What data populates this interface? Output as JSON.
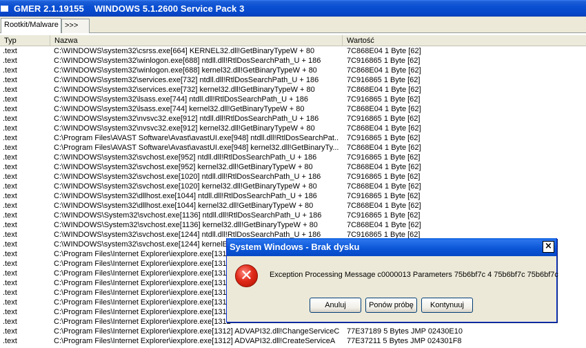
{
  "window": {
    "title": "GMER 2.1.19155    WINDOWS 5.1.2600 Service Pack 3"
  },
  "tabs": [
    {
      "label": "Rootkit/Malware"
    },
    {
      "label": ">>>"
    }
  ],
  "columns": {
    "typ": "Typ",
    "nazwa": "Nazwa",
    "wartosc": "Wartość"
  },
  "rows": [
    {
      "typ": ".text",
      "nazwa": "C:\\WINDOWS\\system32\\csrss.exe[664] KERNEL32.dll!GetBinaryTypeW + 80",
      "wartosc": "7C868E04 1 Byte  [62]"
    },
    {
      "typ": ".text",
      "nazwa": "C:\\WINDOWS\\system32\\winlogon.exe[688] ntdll.dll!RtlDosSearchPath_U + 186",
      "wartosc": "7C916865 1 Byte  [62]"
    },
    {
      "typ": ".text",
      "nazwa": "C:\\WINDOWS\\system32\\winlogon.exe[688] kernel32.dll!GetBinaryTypeW + 80",
      "wartosc": "7C868E04 1 Byte  [62]"
    },
    {
      "typ": ".text",
      "nazwa": "C:\\WINDOWS\\system32\\services.exe[732] ntdll.dll!RtlDosSearchPath_U + 186",
      "wartosc": "7C916865 1 Byte  [62]"
    },
    {
      "typ": ".text",
      "nazwa": "C:\\WINDOWS\\system32\\services.exe[732] kernel32.dll!GetBinaryTypeW + 80",
      "wartosc": "7C868E04 1 Byte  [62]"
    },
    {
      "typ": ".text",
      "nazwa": "C:\\WINDOWS\\system32\\lsass.exe[744] ntdll.dll!RtlDosSearchPath_U + 186",
      "wartosc": "7C916865 1 Byte  [62]"
    },
    {
      "typ": ".text",
      "nazwa": "C:\\WINDOWS\\system32\\lsass.exe[744] kernel32.dll!GetBinaryTypeW + 80",
      "wartosc": "7C868E04 1 Byte  [62]"
    },
    {
      "typ": ".text",
      "nazwa": "C:\\WINDOWS\\system32\\nvsvc32.exe[912] ntdll.dll!RtlDosSearchPath_U + 186",
      "wartosc": "7C916865 1 Byte  [62]"
    },
    {
      "typ": ".text",
      "nazwa": "C:\\WINDOWS\\system32\\nvsvc32.exe[912] kernel32.dll!GetBinaryTypeW + 80",
      "wartosc": "7C868E04 1 Byte  [62]"
    },
    {
      "typ": ".text",
      "nazwa": "C:\\Program Files\\AVAST Software\\Avast\\avastUI.exe[948] ntdll.dll!RtlDosSearchPat...",
      "wartosc": "7C916865 1 Byte  [62]"
    },
    {
      "typ": ".text",
      "nazwa": "C:\\Program Files\\AVAST Software\\Avast\\avastUI.exe[948] kernel32.dll!GetBinaryTy...",
      "wartosc": "7C868E04 1 Byte  [62]"
    },
    {
      "typ": ".text",
      "nazwa": "C:\\WINDOWS\\system32\\svchost.exe[952] ntdll.dll!RtlDosSearchPath_U + 186",
      "wartosc": "7C916865 1 Byte  [62]"
    },
    {
      "typ": ".text",
      "nazwa": "C:\\WINDOWS\\system32\\svchost.exe[952] kernel32.dll!GetBinaryTypeW + 80",
      "wartosc": "7C868E04 1 Byte  [62]"
    },
    {
      "typ": ".text",
      "nazwa": "C:\\WINDOWS\\system32\\svchost.exe[1020] ntdll.dll!RtlDosSearchPath_U + 186",
      "wartosc": "7C916865 1 Byte  [62]"
    },
    {
      "typ": ".text",
      "nazwa": "C:\\WINDOWS\\system32\\svchost.exe[1020] kernel32.dll!GetBinaryTypeW + 80",
      "wartosc": "7C868E04 1 Byte  [62]"
    },
    {
      "typ": ".text",
      "nazwa": "C:\\WINDOWS\\system32\\dllhost.exe[1044] ntdll.dll!RtlDosSearchPath_U + 186",
      "wartosc": "7C916865 1 Byte  [62]"
    },
    {
      "typ": ".text",
      "nazwa": "C:\\WINDOWS\\system32\\dllhost.exe[1044] kernel32.dll!GetBinaryTypeW + 80",
      "wartosc": "7C868E04 1 Byte  [62]"
    },
    {
      "typ": ".text",
      "nazwa": "C:\\WINDOWS\\System32\\svchost.exe[1136] ntdll.dll!RtlDosSearchPath_U + 186",
      "wartosc": "7C916865 1 Byte  [62]"
    },
    {
      "typ": ".text",
      "nazwa": "C:\\WINDOWS\\System32\\svchost.exe[1136] kernel32.dll!GetBinaryTypeW + 80",
      "wartosc": "7C868E04 1 Byte  [62]"
    },
    {
      "typ": ".text",
      "nazwa": "C:\\WINDOWS\\system32\\svchost.exe[1244] ntdll.dll!RtlDosSearchPath_U + 186",
      "wartosc": "7C916865 1 Byte  [62]"
    },
    {
      "typ": ".text",
      "nazwa": "C:\\WINDOWS\\system32\\svchost.exe[1244] kernelE",
      "wartosc": ""
    },
    {
      "typ": ".text",
      "nazwa": "C:\\Program Files\\Internet Explorer\\iexplore.exe[1312",
      "wartosc": ""
    },
    {
      "typ": ".text",
      "nazwa": "C:\\Program Files\\Internet Explorer\\iexplore.exe[1312",
      "wartosc": ""
    },
    {
      "typ": ".text",
      "nazwa": "C:\\Program Files\\Internet Explorer\\iexplore.exe[1312",
      "wartosc": ""
    },
    {
      "typ": ".text",
      "nazwa": "C:\\Program Files\\Internet Explorer\\iexplore.exe[1312",
      "wartosc": ""
    },
    {
      "typ": ".text",
      "nazwa": "C:\\Program Files\\Internet Explorer\\iexplore.exe[1312",
      "wartosc": ""
    },
    {
      "typ": ".text",
      "nazwa": "C:\\Program Files\\Internet Explorer\\iexplore.exe[1312",
      "wartosc": ""
    },
    {
      "typ": ".text",
      "nazwa": "C:\\Program Files\\Internet Explorer\\iexplore.exe[1312",
      "wartosc": ""
    },
    {
      "typ": ".text",
      "nazwa": "C:\\Program Files\\Internet Explorer\\iexplore.exe[1312",
      "wartosc": ""
    },
    {
      "typ": ".text",
      "nazwa": "C:\\Program Files\\Internet Explorer\\iexplore.exe[1312] ADVAPI32.dll!ChangeServiceC...",
      "wartosc": "77E37189 5 Bytes  JMP 02430E10"
    },
    {
      "typ": ".text",
      "nazwa": "C:\\Program Files\\Internet Explorer\\iexplore.exe[1312] ADVAPI32.dll!CreateServiceA",
      "wartosc": "77E37211 5 Bytes  JMP 024301F8"
    }
  ],
  "dialog": {
    "title": "System Windows - Brak dysku",
    "message": "Exception Processing Message c0000013 Parameters 75b6bf7c 4 75b6bf7c 75b6bf7c",
    "close_label": "×",
    "icon_label": "✕",
    "buttons": {
      "cancel": "Anuluj",
      "retry": "Ponów próbę",
      "continue": "Kontynuuj"
    }
  },
  "icons": {
    "window": "app-icon",
    "dialog": "error-icon"
  },
  "colors": {
    "titlebar": "#0a4fd2",
    "dialog_title": "#0a55d6",
    "error_icon": "#e02a1a",
    "face": "#ece9d8"
  }
}
